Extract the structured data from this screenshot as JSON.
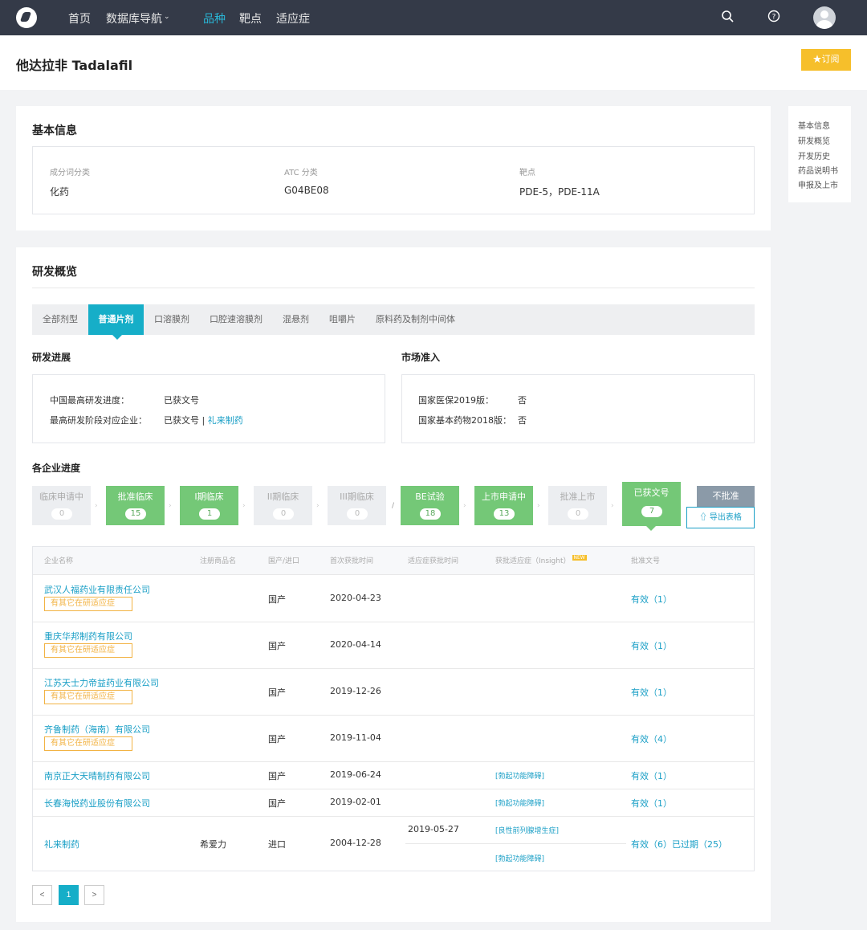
{
  "nav": {
    "items": [
      "首页",
      "数据库导航",
      "品种",
      "靶点",
      "适应症"
    ],
    "active_index": 2
  },
  "header": {
    "title": "他达拉非 Tadalafil",
    "subscribe_label": "订阅"
  },
  "basic_info": {
    "title": "基本信息",
    "fields": [
      {
        "label": "成分词分类",
        "value": "化药"
      },
      {
        "label": "ATC 分类",
        "value": "G04BE08"
      },
      {
        "label": "靶点",
        "value": "PDE-5，PDE-11A"
      }
    ]
  },
  "side_nav": [
    "基本信息",
    "研发概览",
    "开发历史",
    "药品说明书",
    "申报及上市"
  ],
  "overview": {
    "title": "研发概览",
    "tabs": [
      "全部剂型",
      "普通片剂",
      "口溶膜剂",
      "口腔速溶膜剂",
      "混悬剂",
      "咀嚼片",
      "原料药及制剂中间体"
    ],
    "active_tab": 1,
    "progress": {
      "title": "研发进展",
      "highest_label": "中国最高研发进度：",
      "highest_value": "已获文号",
      "company_label": "最高研发阶段对应企业：",
      "company_value": "已获文号",
      "company_link": "礼来制药"
    },
    "market": {
      "title": "市场准入",
      "insurance_label": "国家医保2019版：",
      "insurance_value": "否",
      "essential_label": "国家基本药物2018版：",
      "essential_value": "否"
    }
  },
  "enterprise": {
    "title": "各企业进度",
    "stages": [
      {
        "name": "临床申请中",
        "count": "0"
      },
      {
        "name": "批准临床",
        "count": "15"
      },
      {
        "name": "I期临床",
        "count": "1"
      },
      {
        "name": "II期临床",
        "count": "0"
      },
      {
        "name": "III期临床",
        "count": "0"
      },
      {
        "name": "BE试验",
        "count": "18"
      },
      {
        "name": "上市申请中",
        "count": "13"
      },
      {
        "name": "批准上市",
        "count": "0"
      },
      {
        "name": "已获文号",
        "count": "7"
      }
    ],
    "reject_label": "不批准",
    "export_label": "导出表格",
    "columns": [
      "企业名称",
      "注册商品名",
      "国产/进口",
      "首次获批时间",
      "适应症获批时间",
      "获批适应症（Insight）",
      "批准文号"
    ],
    "new_badge": "NEW",
    "tag_text": "有其它在研适应症",
    "rows": [
      {
        "company": "武汉人福药业有限责任公司",
        "brand": "",
        "origin": "国产",
        "first": "2020-04-23",
        "ind_time": "",
        "indications": [],
        "approval": "有效（1）"
      },
      {
        "company": "重庆华邦制药有限公司",
        "brand": "",
        "origin": "国产",
        "first": "2020-04-14",
        "ind_time": "",
        "indications": [],
        "approval": "有效（1）"
      },
      {
        "company": "江苏天士力帝益药业有限公司",
        "brand": "",
        "origin": "国产",
        "first": "2019-12-26",
        "ind_time": "",
        "indications": [],
        "approval": "有效（1）"
      },
      {
        "company": "齐鲁制药（海南）有限公司",
        "brand": "",
        "origin": "国产",
        "first": "2019-11-04",
        "ind_time": "",
        "indications": [],
        "approval": "有效（4）"
      },
      {
        "company": "南京正大天晴制药有限公司",
        "brand": "",
        "origin": "国产",
        "first": "2019-06-24",
        "ind_time": "",
        "indications": [
          "[勃起功能障碍]"
        ],
        "approval": "有效（1）"
      },
      {
        "company": "长春海悦药业股份有限公司",
        "brand": "",
        "origin": "国产",
        "first": "2019-02-01",
        "ind_time": "",
        "indications": [
          "[勃起功能障碍]"
        ],
        "approval": "有效（1）"
      },
      {
        "company": "礼来制药",
        "brand": "希爱力",
        "origin": "进口",
        "first": "2004-12-28",
        "ind_time": "2019-05-27",
        "indications": [
          "[良性前列腺增生症]",
          "[勃起功能障碍]"
        ],
        "approval": "有效（6）已过期（25）"
      }
    ]
  },
  "pagination": {
    "prev": "<",
    "current": "1",
    "next": ">"
  }
}
